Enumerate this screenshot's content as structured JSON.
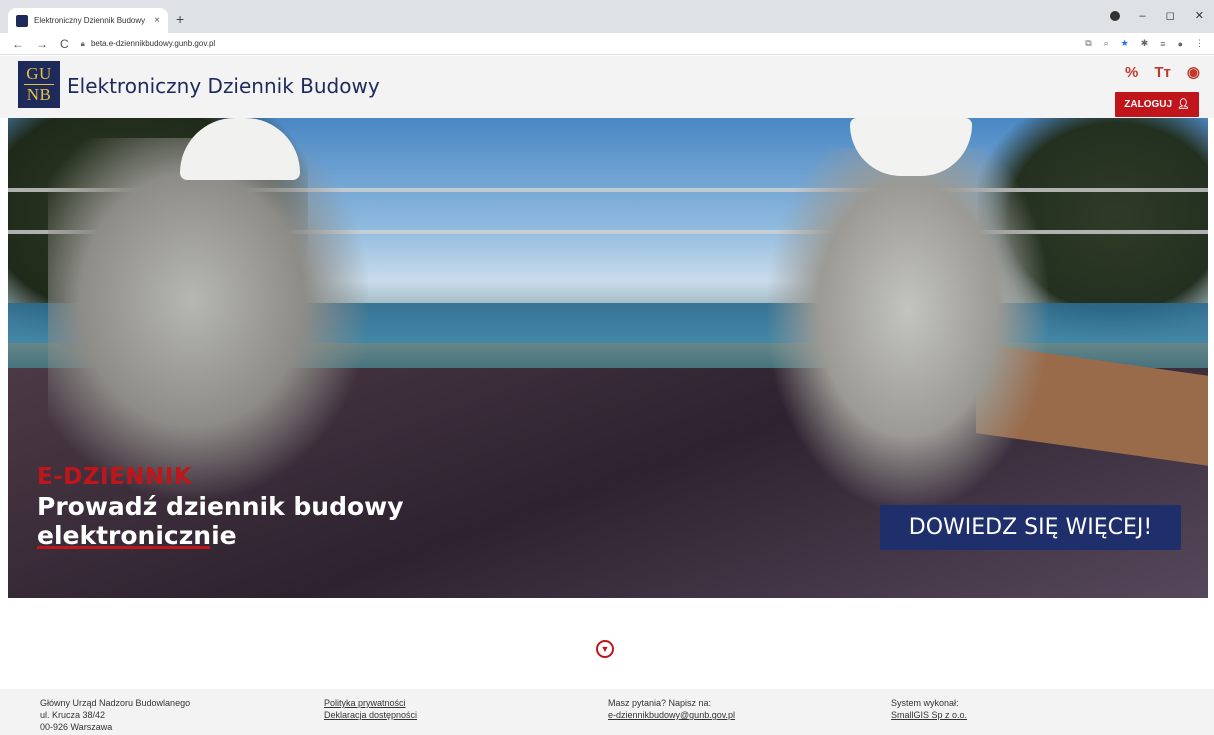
{
  "browser": {
    "tab_title": "Elektroniczny Dziennik Budowy",
    "tab_close": "×",
    "new_tab": "+",
    "url": "beta.e-dziennikbudowy.gunb.gov.pl",
    "win_minimize": "–",
    "win_restore": "◻",
    "win_close": "✕",
    "nav_back": "←",
    "nav_forward": "→",
    "nav_reload": "C"
  },
  "header": {
    "logo_top": "GU",
    "logo_bottom": "NB",
    "site_title": "Elektroniczny Dziennik Budowy",
    "acc_contrast": "%",
    "acc_font": "Tт",
    "acc_eye": "◉",
    "login_label": "ZALOGUJ"
  },
  "hero": {
    "kicker": "E-DZIENNIK",
    "headline_line1": "Prowadź dziennik budowy",
    "headline_line2": "elektronicznie",
    "cta_label": "DOWIEDZ SIĘ WIĘCEJ!"
  },
  "footer": {
    "org_name": "Główny Urząd Nadzoru Budowlanego",
    "address_street": "ul. Krucza 38/42",
    "address_city": "00-926 Warszawa",
    "privacy_link": "Polityka prywatności",
    "accessibility_link": "Deklaracja dostępności",
    "questions_label": "Masz pytania? Napisz na:",
    "email_link": "e-dziennikbudowy@gunb.gov.pl",
    "vendor_label": "System wykonał:",
    "vendor_link": "SmallGIS Sp z o.o."
  },
  "colors": {
    "brand_navy": "#1e2a5a",
    "brand_red": "#c0151b",
    "cta_blue": "#1e2f6b"
  }
}
